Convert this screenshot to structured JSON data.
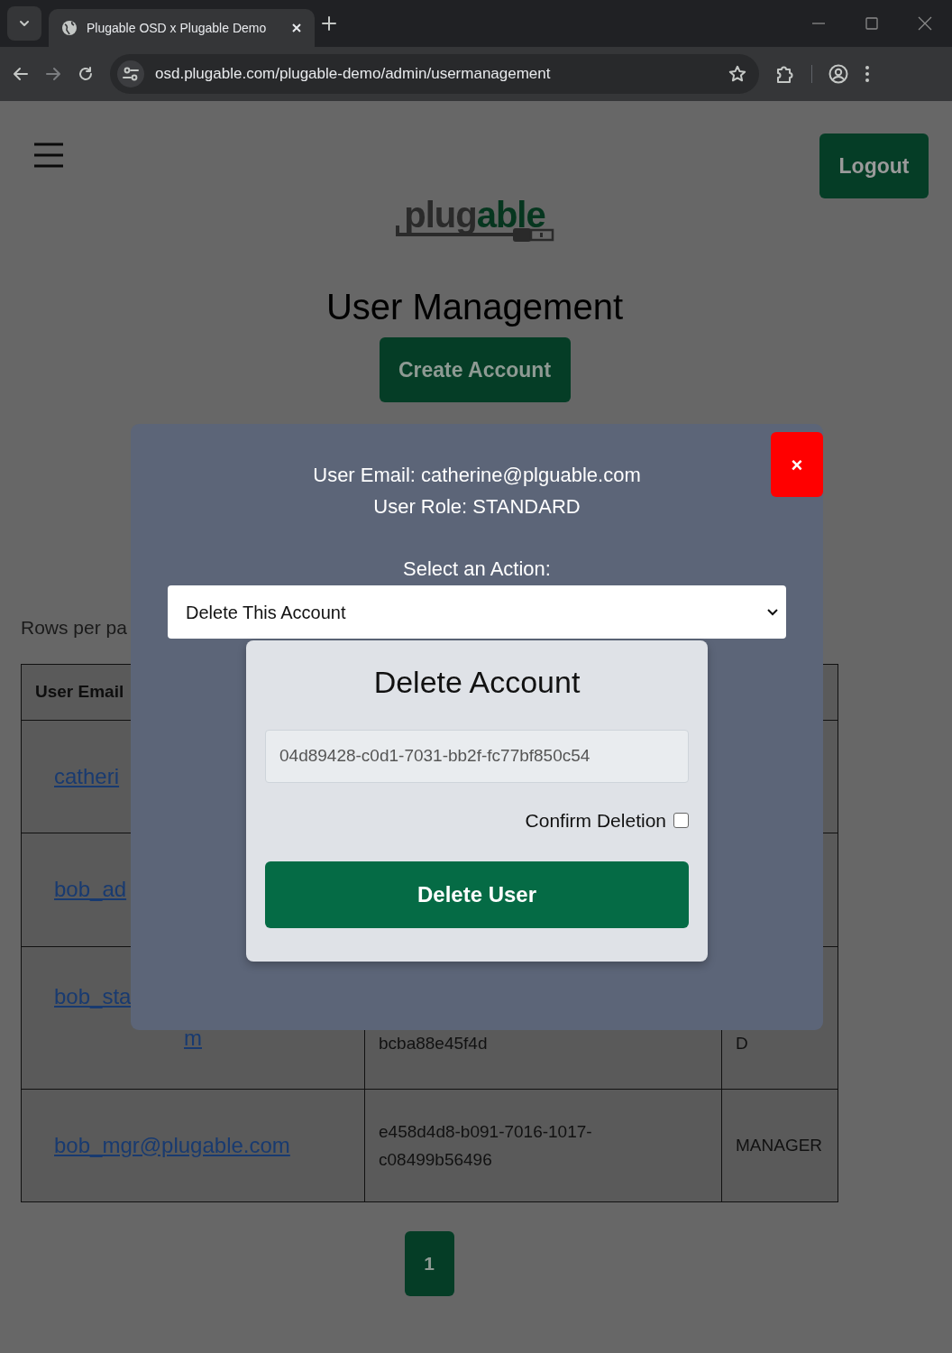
{
  "browser": {
    "tab_title": "Plugable OSD x Plugable Demo",
    "url": "osd.plugable.com/plugable-demo/admin/usermanagement"
  },
  "header": {
    "logout": "Logout",
    "logo_parts": [
      {
        "text": "plug",
        "accent": false
      },
      {
        "text": "able",
        "accent": true
      }
    ]
  },
  "page": {
    "title": "User Management",
    "create_button": "Create Account",
    "rows_per_page_label": "Rows per pa"
  },
  "table": {
    "columns": [
      "User Email"
    ],
    "rows": [
      {
        "email_lines": [
          "catheri"
        ]
      },
      {
        "email_lines": [
          "bob_ad"
        ]
      },
      {
        "email_lines": [
          "bob_sta",
          "m"
        ],
        "id_lines": [
          "bcba88e45f4d"
        ],
        "role_lines": [
          "D"
        ],
        "continued": true
      },
      {
        "email_lines": [
          "bob_mgr@plugable.com"
        ],
        "id_lines": [
          "e458d4d8-b091-7016-1017-",
          "c08499b56496"
        ],
        "role_lines": [
          "MANAGER"
        ],
        "continued": false
      }
    ]
  },
  "pagination": [
    {
      "label": "1",
      "selected": true
    }
  ],
  "modal": {
    "close": "×",
    "email_line": "User Email: catherine@plguable.com",
    "role_line": "User Role: STANDARD",
    "select_label": "Select an Action:",
    "select_value": "Delete This Account",
    "dialog": {
      "title": "Delete Account",
      "id_value": "04d89428-c0d1-7031-bb2f-fc77bf850c54",
      "confirm_label": "Confirm Deletion",
      "confirm_checked": false,
      "submit": "Delete User"
    }
  }
}
